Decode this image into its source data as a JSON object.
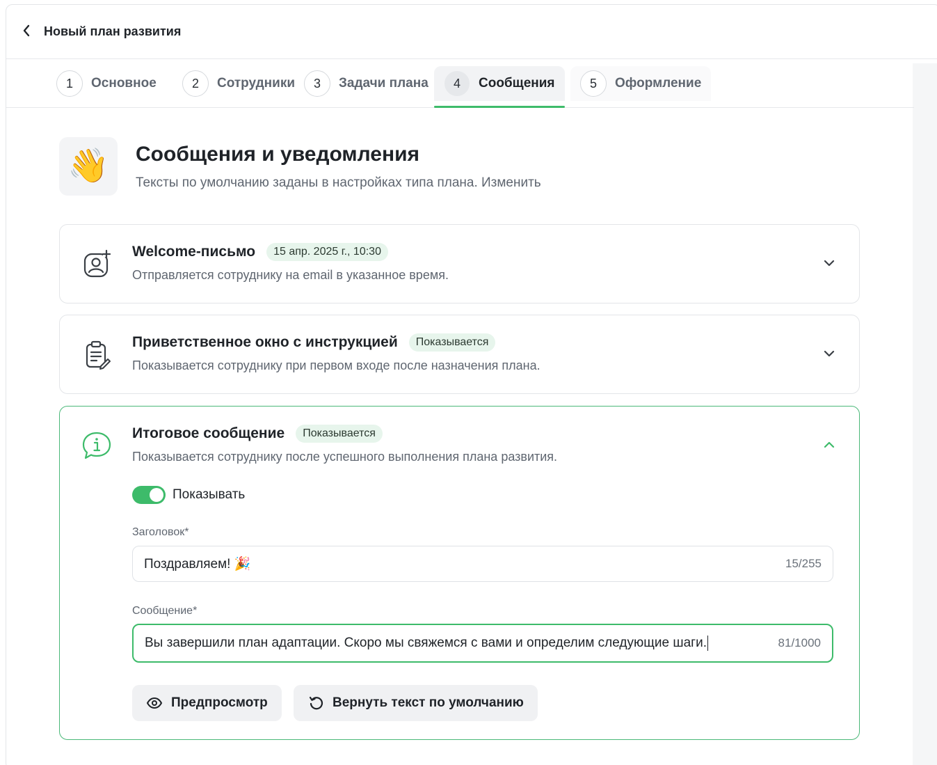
{
  "header": {
    "title": "Новый план развития"
  },
  "steps": [
    {
      "num": "1",
      "label": "Основное"
    },
    {
      "num": "2",
      "label": "Сотрудники"
    },
    {
      "num": "3",
      "label": "Задачи плана"
    },
    {
      "num": "4",
      "label": "Сообщения"
    },
    {
      "num": "5",
      "label": "Оформление"
    }
  ],
  "active_step": 4,
  "hero": {
    "icon": "waving-hand-emoji",
    "emoji": "👋",
    "title": "Сообщения и уведомления",
    "subtitle": "Тексты по умолчанию заданы в настройках типа плана. Изменить"
  },
  "cards": [
    {
      "icon": "user-plus-icon",
      "title": "Welcome-письмо",
      "badge": "15 апр. 2025 г., 10:30",
      "description": "Отправляется сотруднику на email в указанное время.",
      "expanded": false
    },
    {
      "icon": "clipboard-edit-icon",
      "title": "Приветственное окно с инструкцией",
      "badge": "Показывается",
      "description": "Показывается сотруднику при первом входе после назначения плана.",
      "expanded": false
    },
    {
      "icon": "info-bubble-icon",
      "title": "Итоговое сообщение",
      "badge": "Показывается",
      "description": "Показывается сотруднику после успешного выполнения плана развития.",
      "expanded": true,
      "toggle_label": "Показывать",
      "toggle_on": true,
      "title_field": {
        "label": "Заголовок*",
        "value": "Поздравляем! 🎉",
        "counter": "15/255"
      },
      "message_field": {
        "label": "Сообщение*",
        "value": "Вы завершили план адаптации. Скоро мы свяжемся с вами и определим следующие шаги.",
        "counter": "81/1000"
      },
      "preview_button": "Предпросмотр",
      "reset_button": "Вернуть текст по умолчанию"
    }
  ],
  "colors": {
    "accent": "#3dbb6a",
    "badge_bg": "#e7f5ec",
    "muted_text": "#5f6670"
  }
}
